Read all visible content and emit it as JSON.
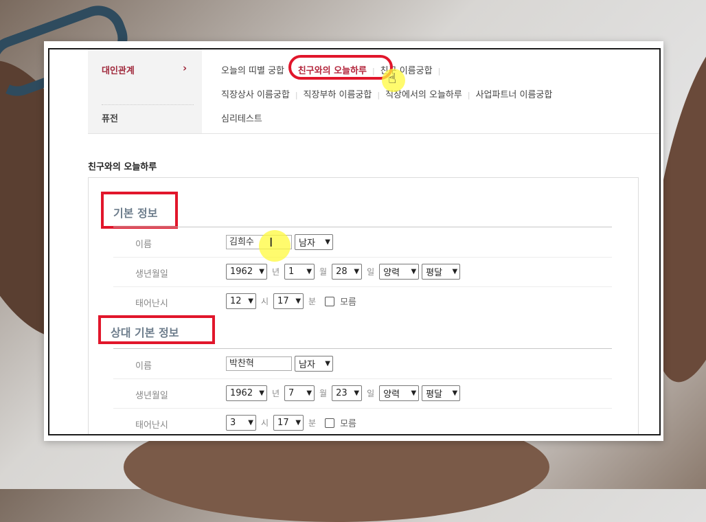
{
  "menu": {
    "categories": [
      "대인관계",
      "퓨전"
    ],
    "arrow": "›",
    "row1": [
      "오늘의 띠별 궁합",
      "친구와의 오늘하루",
      "친구 이름궁합"
    ],
    "row2": [
      "직장상사 이름궁합",
      "직장부하 이름궁합",
      "직장에서의 오늘하루",
      "사업파트너 이름궁합"
    ],
    "row3": [
      "심리테스트"
    ],
    "separator": "|"
  },
  "page_title": "친구와의 오늘하루",
  "my_info": {
    "title": "기본 정보",
    "name_label": "이름",
    "name_value": "김희수",
    "gender": "남자",
    "birth_label": "생년월일",
    "year": "1962",
    "year_unit": "년",
    "month": "1",
    "month_unit": "월",
    "day": "28",
    "day_unit": "일",
    "calendar": "양력",
    "leap": "평달",
    "time_label": "태어난시",
    "hour": "12",
    "hour_unit": "시",
    "minute": "17",
    "minute_unit": "분",
    "unknown_label": "모름"
  },
  "partner_info": {
    "title": "상대 기본 정보",
    "name_label": "이름",
    "name_value": "박찬혁",
    "gender": "남자",
    "birth_label": "생년월일",
    "year": "1962",
    "year_unit": "년",
    "month": "7",
    "month_unit": "월",
    "day": "23",
    "day_unit": "일",
    "calendar": "양력",
    "leap": "평달",
    "time_label": "태어난시",
    "hour": "3",
    "hour_unit": "시",
    "minute": "17",
    "minute_unit": "분",
    "unknown_label": "모름"
  },
  "icons": {
    "chevron": "chevron-down-icon",
    "hand_cursor": "hand-pointer-icon",
    "text_cursor": "text-cursor-icon"
  },
  "colors": {
    "accent": "#b3263c",
    "annotation_red": "#e1162b",
    "section_title": "#6d7d8c",
    "highlight": "#fffa3c"
  }
}
